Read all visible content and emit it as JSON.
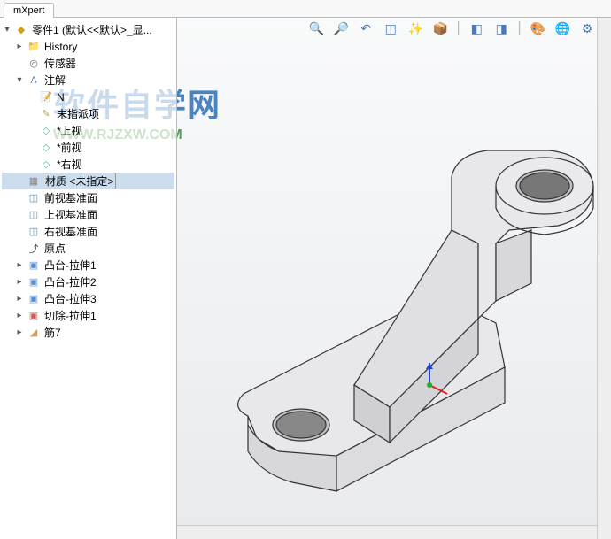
{
  "tab": {
    "label": "mXpert"
  },
  "tree": {
    "root": "零件1  (默认<<默认>_显...",
    "history": "History",
    "sensors": "传感器",
    "annotations": "注解",
    "note": "N",
    "unassigned": "未指派项",
    "top_view": "*上视",
    "front_view": "*前视",
    "right_view": "*右视",
    "material": "材质 <未指定>",
    "front_plane": "前视基准面",
    "top_plane": "上视基准面",
    "right_plane": "右视基准面",
    "origin": "原点",
    "boss1": "凸台-拉伸1",
    "boss2": "凸台-拉伸2",
    "boss3": "凸台-拉伸3",
    "cut1": "切除-拉伸1",
    "rib": "筋7"
  },
  "watermark": {
    "main": "软件自学网",
    "sub": "WWW.RJZXW.COM"
  },
  "toolbar": {
    "zoom_fit": "🔍",
    "zoom_area": "🔎",
    "prev_view": "↶",
    "section": "◫",
    "display": "✨",
    "scene": "📦",
    "appear": "◧",
    "hide": "◨",
    "render1": "🎨",
    "render2": "🌐",
    "settings": "⚙"
  }
}
